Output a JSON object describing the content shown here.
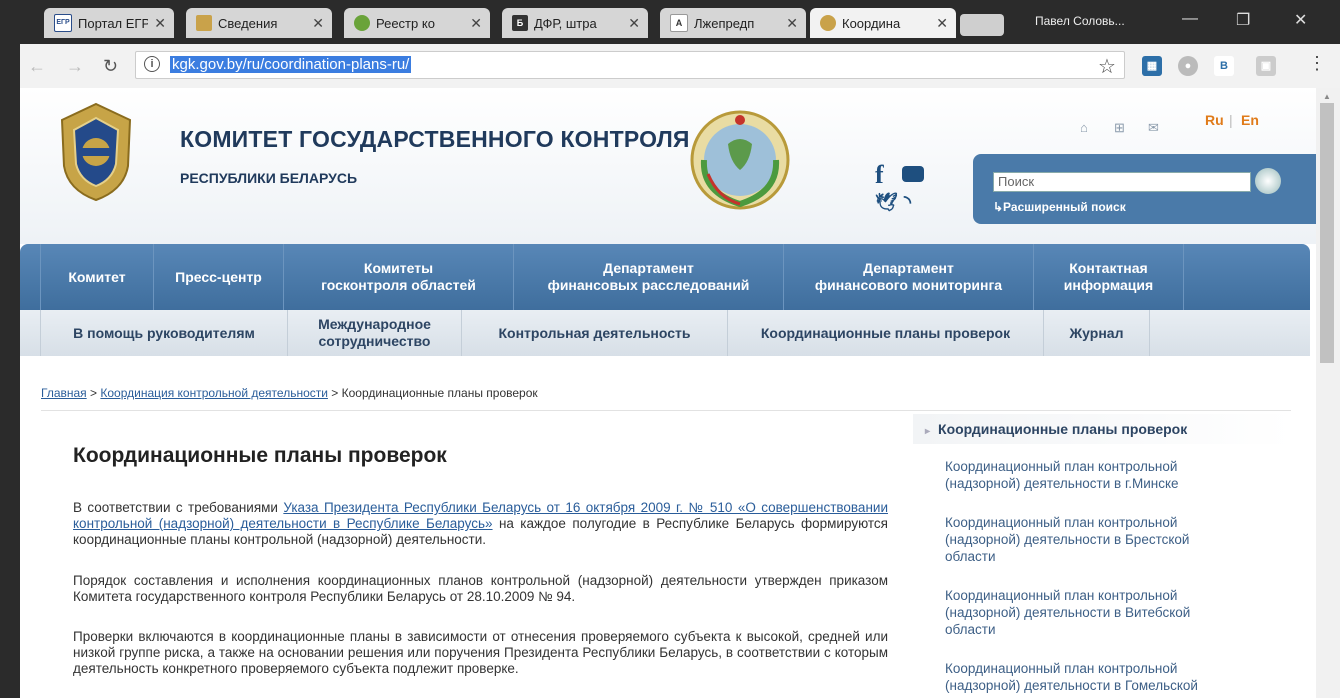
{
  "browser": {
    "tabs": [
      {
        "icon": "egr-icon",
        "title": "Портал ЕГР",
        "badge": "ЕГР"
      },
      {
        "icon": "people-icon",
        "title": "Сведения",
        "badge": ""
      },
      {
        "icon": "circle-icon",
        "title": "Реестр ко",
        "badge": ""
      },
      {
        "icon": "b-icon",
        "title": "ДФР, штра",
        "badge": "Б"
      },
      {
        "icon": "a-icon",
        "title": "Лжепредп",
        "badge": "А"
      },
      {
        "icon": "emblem-icon",
        "title": "Координа",
        "badge": ""
      }
    ],
    "user": "Павел Соловь...",
    "url": "kgk.gov.by/ru/coordination-plans-ru/"
  },
  "header": {
    "title": "КОМИТЕТ ГОСУДАРСТВЕННОГО КОНТРОЛЯ",
    "subtitle": "РЕСПУБЛИКИ БЕЛАРУСЬ",
    "lang_ru": "Ru",
    "lang_sep": "|",
    "lang_en": "En",
    "search_placeholder": "Поиск",
    "advanced_search": "↳Расширенный поиск"
  },
  "main_nav": [
    "Комитет",
    "Пресс-центр",
    "Комитеты\nгосконтроля областей",
    "Департамент\nфинансовых расследований",
    "Департамент\nфинансового мониторинга",
    "Контактная\nинформация"
  ],
  "sub_nav": [
    "В помощь руководителям",
    "Международное\nсотрудничество",
    "Контрольная деятельность",
    "Координационные планы проверок",
    "Журнал"
  ],
  "breadcrumb": {
    "home": "Главная",
    "sep1": " > ",
    "section": "Координация контрольной деятельности",
    "sep2": " > ",
    "current": "Координационные планы проверок"
  },
  "content": {
    "title": "Координационные планы проверок",
    "p1_prefix": "В соответствии с требованиями ",
    "p1_link": "Указа Президента Республики Беларусь от 16 октября 2009 г. № 510 «О совершенствовании контрольной (надзорной) деятельности в Республике Беларусь»",
    "p1_suffix": " на каждое полугодие в Республике Беларусь формируются координационные планы контрольной (надзорной) деятельности.",
    "p2": "Порядок составления и исполнения координационных планов контрольной (надзорной) деятельности утвержден приказом Комитета государственного контроля Республики Беларусь от 28.10.2009 № 94.",
    "p3": "Проверки включаются в координационные планы в зависимости от отнесения проверяемого субъекта к высокой, средней или низкой группе риска, а также на основании решения или поручения Президента Республики Беларусь, в соответствии с которым деятельность конкретного проверяемого субъекта подлежит проверке."
  },
  "sidebar": {
    "heading": "Координационные планы проверок",
    "links": [
      "Координационный план контрольной (надзорной) деятельности в г.Минске",
      "Координационный план контрольной (надзорной) деятельности в Брестской области",
      "Координационный план контрольной (надзорной) деятельности в Витебской области",
      "Координационный план контрольной (надзорной) деятельности в Гомельской"
    ]
  },
  "colors": {
    "nav": "#4a7aa9",
    "accent": "#e07b1a",
    "link": "#2a5d9a"
  }
}
